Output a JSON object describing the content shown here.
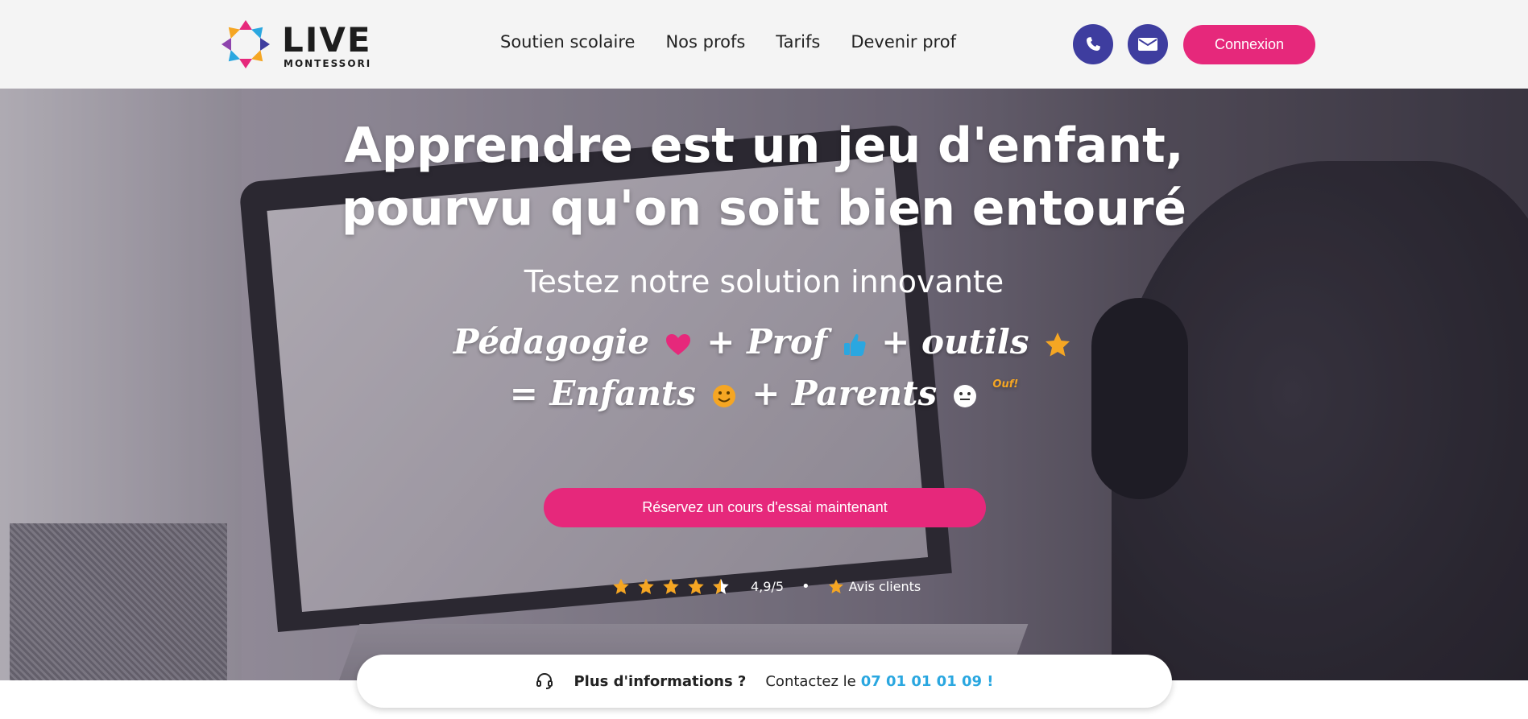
{
  "header": {
    "logo": {
      "word": "LIVE",
      "sub": "MONTESSORI"
    },
    "nav": [
      "Soutien scolaire",
      "Nos profs",
      "Tarifs",
      "Devenir prof"
    ],
    "phone_icon": "phone-icon",
    "mail_icon": "mail-icon",
    "login_label": "Connexion"
  },
  "hero": {
    "title_line1": "Apprendre est un jeu d'enfant,",
    "title_line2": "pourvu qu'on soit bien entouré",
    "subtitle": "Testez notre solution innovante",
    "formula": {
      "pedagogie": "Pédagogie",
      "plus1": "+",
      "prof": "Prof",
      "plus2": "+",
      "outils": "outils",
      "equals": "=",
      "enfants": "Enfants",
      "plus3": "+",
      "parents": "Parents",
      "ouf": "Ouf!"
    },
    "cta_label": "Réservez un cours d'essai maintenant",
    "rating": {
      "stars": 4.5,
      "value": "4,9/5",
      "separator": "•",
      "reviews_label": "Avis clients"
    }
  },
  "info_bar": {
    "question": "Plus d'informations ?",
    "contact_text": "Contactez le",
    "phone": "07 01 01 01 09 !"
  },
  "colors": {
    "primary_pink": "#e6287b",
    "indigo": "#3e3d9f",
    "link_blue": "#2aa7e0",
    "star": "#f5a623"
  }
}
